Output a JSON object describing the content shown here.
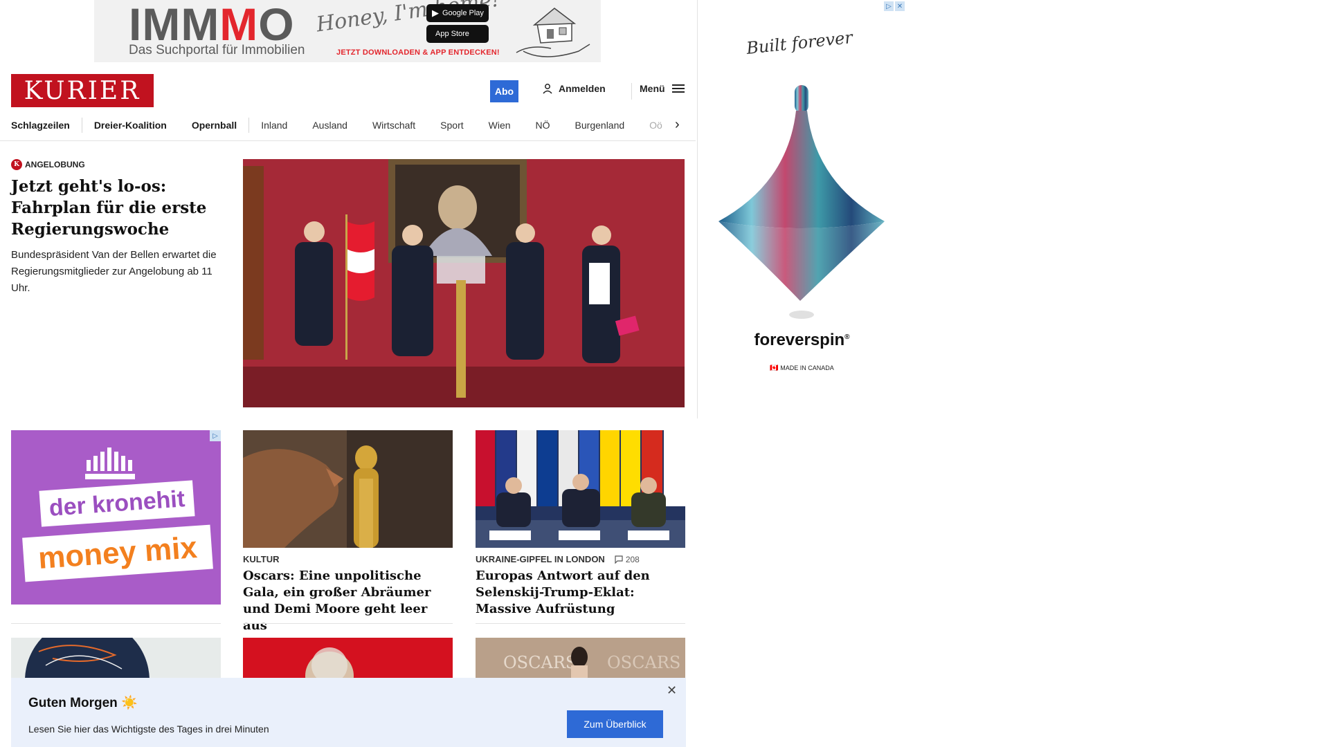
{
  "top_ad": {
    "brand_gray": "IMM",
    "brand_red": "M",
    "brand_end": "O",
    "tagline": "Das Suchportal für Immobilien",
    "script": "Honey, I'm home!",
    "google_play": "Google Play",
    "app_store": "App Store",
    "cta": "JETZT DOWNLOADEN & APP ENTDECKEN!"
  },
  "side_ad": {
    "script": "Built forever",
    "brand": "foreverspin",
    "made": "MADE IN CANADA"
  },
  "header": {
    "logo": "KURIER",
    "abo": "Abo",
    "login": "Anmelden",
    "menu": "Menü"
  },
  "nav": {
    "items": [
      "Schlagzeilen",
      "Dreier-Koalition",
      "Opernball",
      "Inland",
      "Ausland",
      "Wirtschaft",
      "Sport",
      "Wien",
      "NÖ",
      "Burgenland",
      "Oö"
    ]
  },
  "lead": {
    "tag": "ANGELOBUNG",
    "title": "Jetzt geht's lo-os: Fahrplan für die erste Regierungswoche",
    "teaser": "Bundespräsident Van der Bellen erwartet die Regierungsmitglieder zur Angelobung ab 11 Uhr."
  },
  "krone_ad": {
    "line1": "der kronehit",
    "line2": "money mix"
  },
  "cards": [
    {
      "tag": "KULTUR",
      "title": "Oscars: Eine unpolitische Gala, ein großer Abräumer und Demi Moore geht leer aus"
    },
    {
      "tag": "UKRAINE-GIPFEL IN LONDON",
      "comments": "208",
      "title": "Europas Antwort auf den Selenskij-Trump-Eklat: Massive Aufrüstung"
    }
  ],
  "toast": {
    "title": "Guten Morgen ☀️",
    "text": "Lesen Sie hier das Wichtigste des Tages in drei Minuten",
    "button": "Zum Überblick"
  },
  "colors": {
    "brand_red": "#c1121f",
    "accent_blue": "#2e6ad6",
    "toast_bg": "#eaf0fb",
    "ad_purple": "#a95cc8"
  },
  "icons": [
    "user-icon",
    "hamburger-icon",
    "chevron-right-icon",
    "comment-icon",
    "close-icon",
    "adchoices-icon"
  ]
}
